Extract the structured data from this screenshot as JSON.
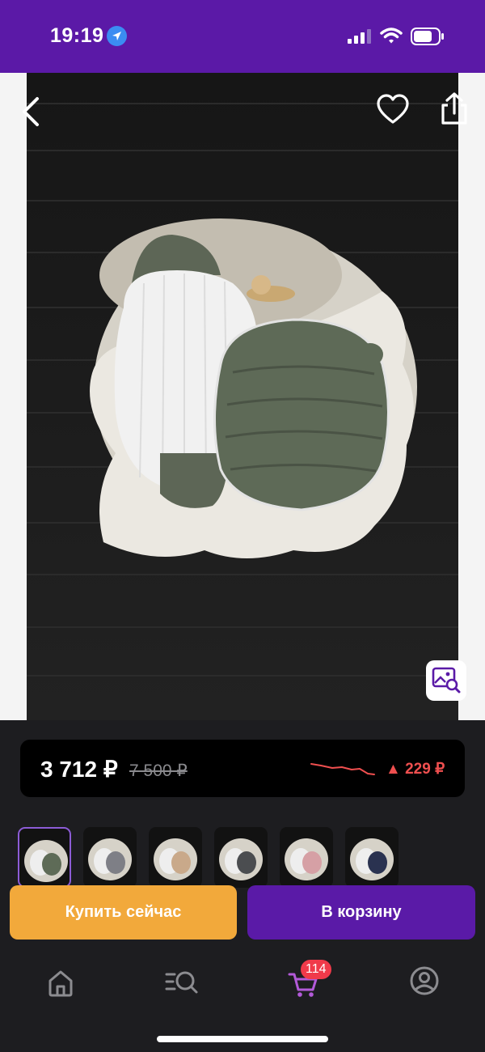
{
  "status_bar": {
    "time": "19:19",
    "icons": [
      "location-arrow-icon",
      "cellular-signal-icon",
      "wifi-icon",
      "battery-icon"
    ]
  },
  "product": {
    "price_current": "3 712 ₽",
    "price_old": "7 500 ₽",
    "price_change": "▲ 229 ₽"
  },
  "thumbnails": [
    {
      "label": "olive",
      "accent": "#5e6b57"
    },
    {
      "label": "grey stripe",
      "accent": "#7e7f86"
    },
    {
      "label": "beige",
      "accent": "#c9a98a"
    },
    {
      "label": "dark grey",
      "accent": "#4b4d50"
    },
    {
      "label": "pink",
      "accent": "#d6a0a5"
    },
    {
      "label": "navy",
      "accent": "#2a3250"
    }
  ],
  "actions": {
    "buy_now": "Купить сейчас",
    "add_to_cart": "В корзину"
  },
  "tabbar": {
    "tabs": [
      "home-icon",
      "catalog-search-icon",
      "cart-icon",
      "profile-icon"
    ],
    "cart_badge": "114"
  },
  "colors": {
    "brand": "#5b19a7",
    "buy_button": "#f2a93b",
    "price_drop": "#ef4f4f",
    "badge": "#f03a4a"
  }
}
